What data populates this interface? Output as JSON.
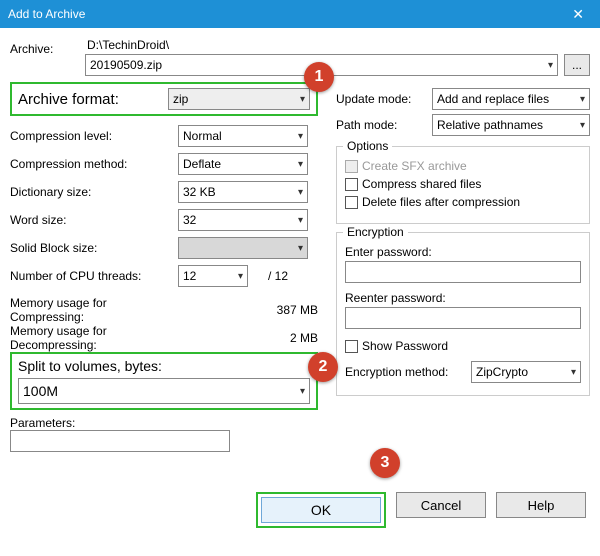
{
  "title": "Add to Archive",
  "archive": {
    "label": "Archive:",
    "path": "D:\\TechinDroid\\",
    "filename": "20190509.zip",
    "browse": "..."
  },
  "badges": {
    "one": "1",
    "two": "2",
    "three": "3"
  },
  "left": {
    "archive_format_label": "Archive format:",
    "archive_format_value": "zip",
    "compression_level_label": "Compression level:",
    "compression_level_value": "Normal",
    "compression_method_label": "Compression method:",
    "compression_method_value": "Deflate",
    "dictionary_size_label": "Dictionary size:",
    "dictionary_size_value": "32 KB",
    "word_size_label": "Word size:",
    "word_size_value": "32",
    "solid_block_label": "Solid Block size:",
    "solid_block_value": "",
    "cpu_threads_label": "Number of CPU threads:",
    "cpu_threads_value": "12",
    "cpu_threads_total": "/ 12",
    "mem_compress_label": "Memory usage for Compressing:",
    "mem_compress_value": "387 MB",
    "mem_decompress_label": "Memory usage for Decompressing:",
    "mem_decompress_value": "2 MB",
    "split_label": "Split to volumes, bytes:",
    "split_value": "100M",
    "parameters_label": "Parameters:",
    "parameters_value": ""
  },
  "right": {
    "update_mode_label": "Update mode:",
    "update_mode_value": "Add and replace files",
    "path_mode_label": "Path mode:",
    "path_mode_value": "Relative pathnames",
    "options_title": "Options",
    "opt_sfx": "Create SFX archive",
    "opt_shared": "Compress shared files",
    "opt_delete": "Delete files after compression",
    "encryption_title": "Encryption",
    "enter_pw_label": "Enter password:",
    "reenter_pw_label": "Reenter password:",
    "show_pw_label": "Show Password",
    "enc_method_label": "Encryption method:",
    "enc_method_value": "ZipCrypto"
  },
  "buttons": {
    "ok": "OK",
    "cancel": "Cancel",
    "help": "Help"
  }
}
